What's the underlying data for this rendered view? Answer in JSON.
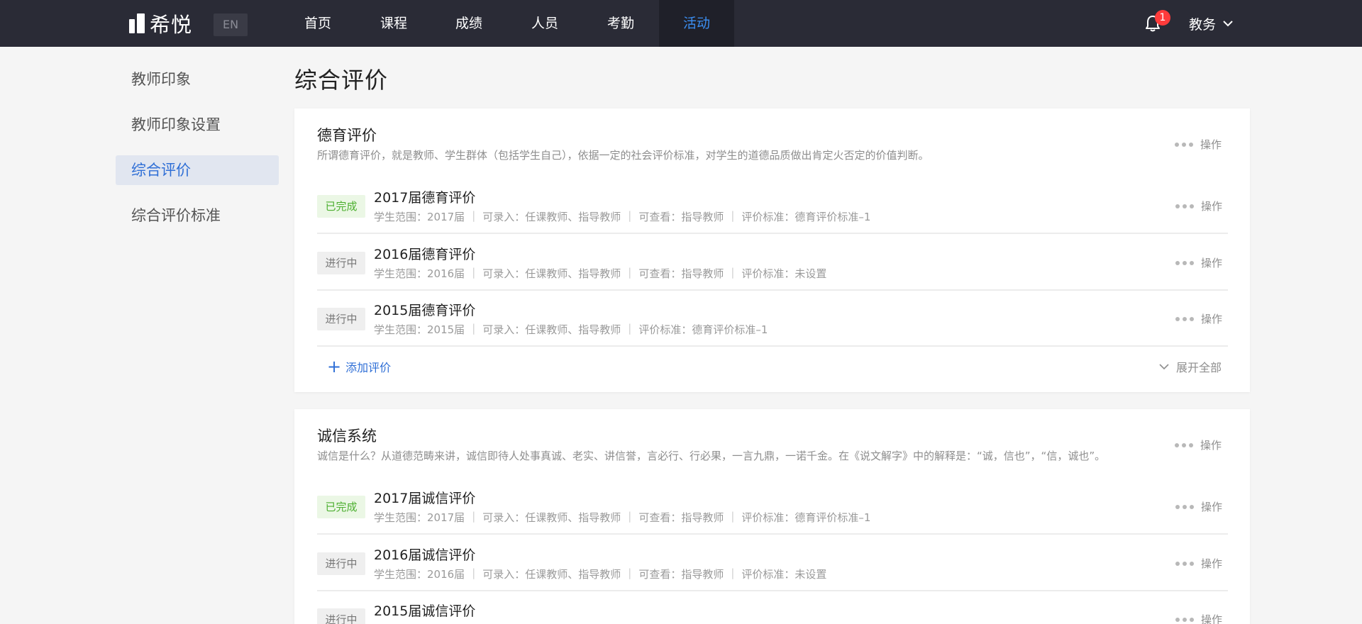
{
  "header": {
    "logo_text": "希悦",
    "lang": "EN",
    "nav": [
      {
        "label": "首页"
      },
      {
        "label": "课程"
      },
      {
        "label": "成绩"
      },
      {
        "label": "人员"
      },
      {
        "label": "考勤"
      },
      {
        "label": "活动",
        "active": true
      }
    ],
    "notification_count": "1",
    "user": "教务"
  },
  "sidebar": {
    "items": [
      {
        "label": "教师印象"
      },
      {
        "label": "教师印象设置"
      },
      {
        "label": "综合评价",
        "active": true
      },
      {
        "label": "综合评价标准"
      }
    ]
  },
  "main": {
    "title": "综合评价",
    "op_label": "操作",
    "sections": [
      {
        "title": "德育评价",
        "desc": "所谓德育评价，就是教师、学生群体（包括学生自己），依据一定的社会评价标准，对学生的道德品质做出肯定火否定的价值判断。",
        "add_label": "添加评价",
        "expand_label": "展开全部",
        "rows": [
          {
            "status": "已完成",
            "status_type": "done",
            "title": "2017届德育评价",
            "meta": [
              "学生范围：2017届",
              "可录入：任课教师、指导教师",
              "可查看：指导教师",
              "评价标准：德育评价标准–1"
            ]
          },
          {
            "status": "进行中",
            "status_type": "doing",
            "title": "2016届德育评价",
            "meta": [
              "学生范围：2016届",
              "可录入：任课教师、指导教师",
              "可查看：指导教师",
              "评价标准：未设置"
            ]
          },
          {
            "status": "进行中",
            "status_type": "doing",
            "title": "2015届德育评价",
            "meta": [
              "学生范围：2015届",
              "可录入：任课教师、指导教师",
              "评价标准：德育评价标准–1"
            ]
          }
        ]
      },
      {
        "title": "诚信系统",
        "desc": "诚信是什么？从道德范畴来讲，诚信即待人处事真诚、老实、讲信誉，言必行、行必果，一言九鼎，一诺千金。在《说文解字》中的解释是：“诚，信也”，“信，诚也”。",
        "rows": [
          {
            "status": "已完成",
            "status_type": "done",
            "title": "2017届诚信评价",
            "meta": [
              "学生范围：2017届",
              "可录入：任课教师、指导教师",
              "可查看：指导教师",
              "评价标准：德育评价标准–1"
            ]
          },
          {
            "status": "进行中",
            "status_type": "doing",
            "title": "2016届诚信评价",
            "meta": [
              "学生范围：2016届",
              "可录入：任课教师、指导教师",
              "可查看：指导教师",
              "评价标准：未设置"
            ]
          },
          {
            "status": "进行中",
            "status_type": "doing",
            "title": "2015届诚信评价",
            "meta": []
          }
        ]
      }
    ]
  },
  "colors": {
    "topbar": "#2a2b36",
    "accent": "#2f6fd6",
    "nav_active": "#3b8ff3",
    "done": "#4caf2f",
    "badge": "#ff3b3b"
  }
}
